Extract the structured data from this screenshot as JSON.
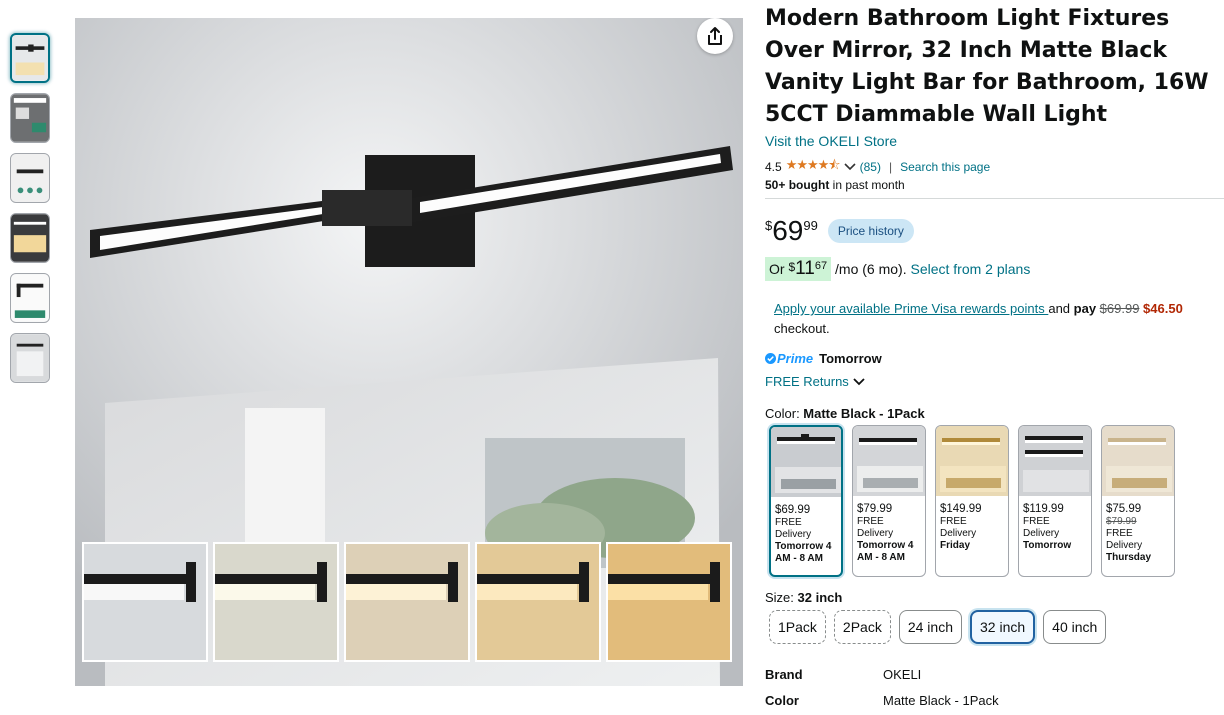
{
  "product": {
    "title": "Modern Bathroom Light Fixtures Over Mirror, 32 Inch Matte Black Vanity Light Bar for Bathroom, 16W 5CCT Diammable Wall Light",
    "store_link": "Visit the OKELI Store",
    "rating_value": "4.5",
    "rating_stars": "★★★★⯪",
    "rating_count": "(85)",
    "search_page_link": "Search this page",
    "bought_bold": "50+ bought",
    "bought_rest": " in past month"
  },
  "price": {
    "symbol": "$",
    "whole": "69",
    "fraction": "99",
    "history_label": "Price history"
  },
  "monthly": {
    "prefix": "Or ",
    "symbol": "$",
    "whole": "11",
    "fraction": "67",
    "suffix": " /mo (6 mo). ",
    "plans_link": "Select from 2 plans"
  },
  "visa": {
    "link": "Apply your available Prime Visa rewards points ",
    "text_and": "and ",
    "pay": "pay ",
    "old_price": "$69.99",
    "new_price": " $46.50",
    "checkout": "checkout."
  },
  "delivery": {
    "prime_label": "Prime",
    "when": "Tomorrow",
    "returns": "FREE Returns"
  },
  "color": {
    "label": "Color: ",
    "selected": "Matte Black - 1Pack",
    "options": [
      {
        "price": "$69.99",
        "old_price": "",
        "delivery": "FREE Delivery",
        "when": "Tomorrow 4 AM - 8 AM"
      },
      {
        "price": "$79.99",
        "old_price": "",
        "delivery": "FREE Delivery",
        "when": "Tomorrow 4 AM - 8 AM"
      },
      {
        "price": "$149.99",
        "old_price": "",
        "delivery": "FREE Delivery",
        "when": "Friday"
      },
      {
        "price": "$119.99",
        "old_price": "",
        "delivery": "FREE Delivery",
        "when": "Tomorrow"
      },
      {
        "price": "$75.99",
        "old_price": "$79.99",
        "delivery": "FREE Delivery",
        "when": "Thursday"
      }
    ]
  },
  "size": {
    "label": "Size: ",
    "selected": "32 inch",
    "options": [
      "1Pack",
      "2Pack",
      "24 inch",
      "32 inch",
      "40 inch"
    ]
  },
  "specs": [
    {
      "key": "Brand",
      "value": "OKELI"
    },
    {
      "key": "Color",
      "value": "Matte Black - 1Pack"
    }
  ],
  "icons": {
    "share": "share-icon",
    "prime_check": "check-icon",
    "chevron": "chevron-down-icon"
  },
  "colors": {
    "link": "#007185",
    "star": "#de7921",
    "price_red": "#b12704",
    "prime_blue": "#1a98ff",
    "selected_border": "#007185"
  }
}
